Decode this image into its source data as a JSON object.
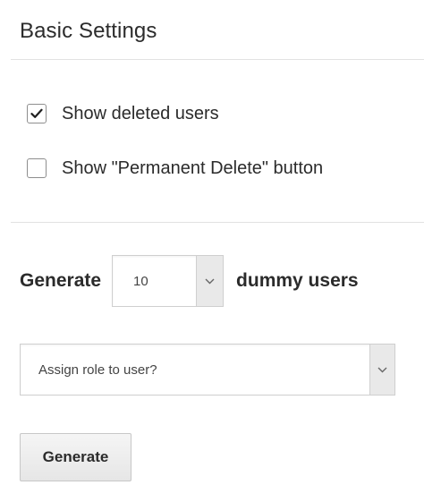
{
  "section": {
    "title": "Basic Settings"
  },
  "options": {
    "show_deleted": {
      "label": "Show deleted users",
      "checked": true
    },
    "show_permanent_delete": {
      "label": "Show \"Permanent Delete\" button",
      "checked": false
    }
  },
  "generator": {
    "prefix": "Generate",
    "count_value": "10",
    "suffix": "dummy users",
    "role_select_value": "Assign role to user?",
    "button_label": "Generate"
  },
  "icons": {
    "checkmark": "checkmark-icon",
    "dropdown": "chevron-down-icon"
  },
  "colors": {
    "text": "#2b2b2b",
    "divider": "#e2e2e2",
    "select_arrow_bg": "#e9e9e9",
    "button_bg": "#eeeeee"
  }
}
